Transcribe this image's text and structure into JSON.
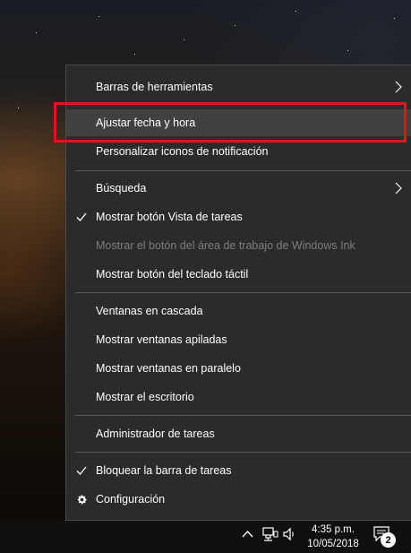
{
  "menu": {
    "items": [
      {
        "label": "Barras de herramientas",
        "has_submenu": true
      },
      {
        "label": "Ajustar fecha y hora",
        "highlighted": true
      },
      {
        "label": "Personalizar iconos de notificación"
      },
      {
        "label": "Búsqueda",
        "has_submenu": true
      },
      {
        "label": "Mostrar botón Vista de tareas",
        "checked": true
      },
      {
        "label": "Mostrar el botón del área de trabajo de Windows Ink",
        "disabled": true
      },
      {
        "label": "Mostrar botón del teclado táctil"
      },
      {
        "label": "Ventanas en cascada"
      },
      {
        "label": "Mostrar ventanas apiladas"
      },
      {
        "label": "Mostrar ventanas en paralelo"
      },
      {
        "label": "Mostrar el escritorio"
      },
      {
        "label": "Administrador de tareas"
      },
      {
        "label": "Bloquear la barra de tareas",
        "checked": true
      },
      {
        "label": "Configuración",
        "icon": "gear-icon"
      }
    ]
  },
  "taskbar": {
    "time": "4:35 p.m.",
    "date": "10/05/2018",
    "notification_count": "2",
    "tray_icons": [
      "chevron-up-icon",
      "network-icon",
      "volume-icon",
      "action-center-icon"
    ]
  },
  "colors": {
    "menu_bg": "#2b2b2b",
    "hover_bg": "#414141",
    "highlight_border": "#e0141f",
    "disabled_text": "#7d7d7d"
  }
}
